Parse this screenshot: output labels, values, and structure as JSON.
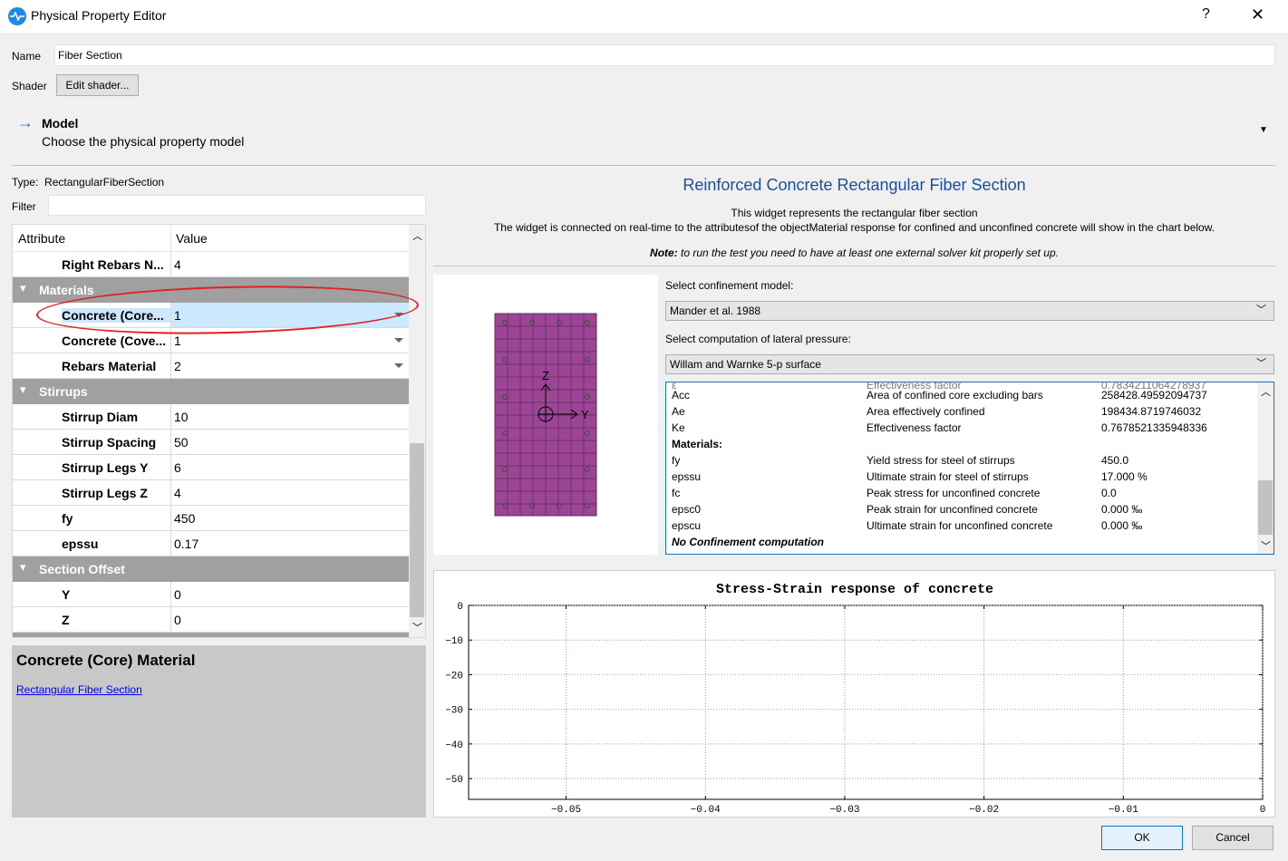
{
  "window": {
    "title": "Physical Property Editor",
    "help": "?",
    "close": "✕"
  },
  "form": {
    "name_label": "Name",
    "name_value": "Fiber Section",
    "shader_label": "Shader",
    "shader_button": "Edit shader..."
  },
  "model": {
    "title": "Model",
    "subtitle": "Choose the physical property model"
  },
  "left": {
    "type_label": "Type:",
    "type_value": "RectangularFiberSection",
    "filter_label": "Filter",
    "filter_value": "",
    "col_attr": "Attribute",
    "col_value": "Value",
    "rows": [
      {
        "kind": "prop",
        "name": "Right Rebars N...",
        "value": "4"
      },
      {
        "kind": "group",
        "name": "Materials"
      },
      {
        "kind": "prop",
        "name": "Concrete (Core...",
        "value": "1",
        "dropdown": true,
        "selected": true
      },
      {
        "kind": "prop",
        "name": "Concrete (Cove...",
        "value": "1",
        "dropdown": true
      },
      {
        "kind": "prop",
        "name": "Rebars Material",
        "value": "2",
        "dropdown": true
      },
      {
        "kind": "group",
        "name": "Stirrups"
      },
      {
        "kind": "prop",
        "name": "Stirrup Diam",
        "value": "10"
      },
      {
        "kind": "prop",
        "name": "Stirrup Spacing",
        "value": "50"
      },
      {
        "kind": "prop",
        "name": "Stirrup Legs Y",
        "value": "6"
      },
      {
        "kind": "prop",
        "name": "Stirrup Legs Z",
        "value": "4"
      },
      {
        "kind": "prop",
        "name": "fy",
        "value": "450"
      },
      {
        "kind": "prop",
        "name": "epssu",
        "value": "0.17"
      },
      {
        "kind": "group",
        "name": "Section Offset"
      },
      {
        "kind": "prop",
        "name": "Y",
        "value": "0"
      },
      {
        "kind": "prop",
        "name": "Z",
        "value": "0"
      }
    ],
    "help_title": "Concrete (Core) Material",
    "help_link": "Rectangular Fiber Section"
  },
  "right": {
    "title": "Reinforced Concrete Rectangular Fiber Section",
    "line1": "This widget represents the rectangular fiber section",
    "line2": "The widget is connected on real-time to the attributesof the objectMaterial response for confined and unconfined concrete will show in the chart below.",
    "note_bold": "Note:",
    "note_text": " to run the test you need to have at least one external solver kit properly set up.",
    "axis_z": "Z",
    "axis_y": "Y",
    "confinement_label": "Select confinement model:",
    "confinement_value": "Mander et al. 1988",
    "lateral_label": "Select computation of lateral pressure:",
    "lateral_value": "Willam and Warnke 5-p surface",
    "table": [
      {
        "a": "Acc",
        "b": "Area of confined core excluding bars",
        "c": "258428.49592094737"
      },
      {
        "a": "Ae",
        "b": "Area effectively confined",
        "c": "198434.8719746032"
      },
      {
        "a": "Ke",
        "b": "Effectiveness factor",
        "c": "0.7678521335948336"
      },
      {
        "a": "Materials:",
        "b": "",
        "c": "",
        "bold": true
      },
      {
        "a": "fy",
        "b": "Yield stress for steel of stirrups",
        "c": "450.0"
      },
      {
        "a": "epssu",
        "b": "Ultimate strain for steel of stirrups",
        "c": "17.000 %"
      },
      {
        "a": "fc",
        "b": "Peak stress for unconfined concrete",
        "c": "0.0"
      },
      {
        "a": "epsc0",
        "b": "Peak strain for unconfined concrete",
        "c": "0.000 ‰"
      },
      {
        "a": "epscu",
        "b": "Ultimate strain for unconfined concrete",
        "c": "0.000 ‰"
      },
      {
        "a": "No Confinement computation",
        "b": "",
        "c": "",
        "bold": true,
        "italic": true
      }
    ]
  },
  "chart_data": {
    "type": "line",
    "title": "Stress-Strain response of concrete",
    "xlabel": "",
    "ylabel": "",
    "xlim": [
      -0.057,
      0
    ],
    "ylim": [
      -56,
      0
    ],
    "x_ticks": [
      -0.05,
      -0.04,
      -0.03,
      -0.02,
      -0.01,
      0
    ],
    "x_tick_labels": [
      "−0.05",
      "−0.04",
      "−0.03",
      "−0.02",
      "−0.01",
      "0"
    ],
    "y_ticks": [
      0,
      -10,
      -20,
      -30,
      -40,
      -50
    ],
    "y_tick_labels": [
      "0",
      "−10",
      "−20",
      "−30",
      "−40",
      "−50"
    ],
    "grid": true,
    "series": []
  },
  "footer": {
    "ok": "OK",
    "cancel": "Cancel"
  }
}
